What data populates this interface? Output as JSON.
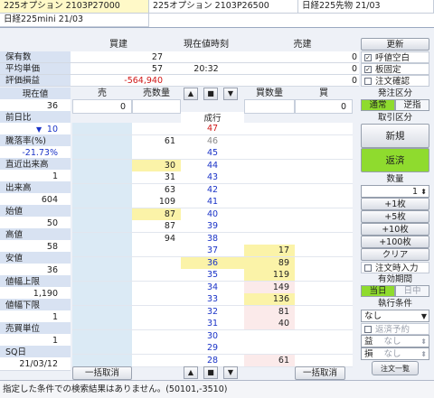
{
  "tabs": [
    "225オプション 2103P27000",
    "225オプション 2103P26500",
    "日経225先物 21/03",
    "日経225mini 21/03"
  ],
  "summary": {
    "headers": {
      "buy": "買建",
      "time": "現在値時刻",
      "sell": "売建"
    },
    "rows": [
      {
        "label": "保有数",
        "buy": "27",
        "time": "",
        "sell": "0"
      },
      {
        "label": "平均単価",
        "buy": "57",
        "time": "20:32",
        "sell": "0"
      },
      {
        "label": "評価損益",
        "buy": "-564,940",
        "time": "",
        "sell": "0"
      }
    ]
  },
  "board_header": {
    "sell": "売",
    "sell_qty": "売数量",
    "buy_qty": "買数量",
    "buy": "買",
    "market": "成行",
    "sell_input": "0",
    "buy_input": "0"
  },
  "quote": [
    {
      "label": "現在値",
      "value": "36",
      "color": "default"
    },
    {
      "label": "前日比",
      "value": "10",
      "color": "blue",
      "arrow": true
    },
    {
      "label": "騰落率(%)",
      "value": "-21.73%",
      "color": "blue"
    },
    {
      "label": "直近出来高",
      "value": "1",
      "color": "default"
    },
    {
      "label": "出来高",
      "value": "604",
      "color": "default"
    },
    {
      "label": "始値",
      "value": "50",
      "color": "default"
    },
    {
      "label": "高値",
      "value": "58",
      "color": "default"
    },
    {
      "label": "安値",
      "value": "36",
      "color": "default"
    },
    {
      "label": "値幅上限",
      "value": "1,190",
      "color": "default"
    },
    {
      "label": "値幅下限",
      "value": "1",
      "color": "default"
    },
    {
      "label": "売買単位",
      "value": "1",
      "color": "default"
    },
    {
      "label": "SQ日",
      "value": "21/03/12",
      "color": "default"
    }
  ],
  "book": [
    {
      "sell_qty": "",
      "price": "47",
      "buy_qty": "",
      "price_color": "red",
      "sq_hl": false,
      "bq_hl": false
    },
    {
      "sell_qty": "61",
      "price": "46",
      "buy_qty": "",
      "price_color": "gray",
      "sq_hl": false,
      "bq_hl": false
    },
    {
      "sell_qty": "",
      "price": "45",
      "buy_qty": "",
      "price_color": "blue",
      "sq_hl": false,
      "bq_hl": false
    },
    {
      "sell_qty": "30",
      "price": "44",
      "buy_qty": "",
      "price_color": "blue",
      "sq_hl": true,
      "bq_hl": false
    },
    {
      "sell_qty": "31",
      "price": "43",
      "buy_qty": "",
      "price_color": "blue",
      "sq_hl": false,
      "bq_hl": false
    },
    {
      "sell_qty": "63",
      "price": "42",
      "buy_qty": "",
      "price_color": "blue",
      "sq_hl": false,
      "bq_hl": false
    },
    {
      "sell_qty": "109",
      "price": "41",
      "buy_qty": "",
      "price_color": "blue",
      "sq_hl": false,
      "bq_hl": false
    },
    {
      "sell_qty": "87",
      "price": "40",
      "buy_qty": "",
      "price_color": "blue",
      "sq_hl": true,
      "bq_hl": false
    },
    {
      "sell_qty": "87",
      "price": "39",
      "buy_qty": "",
      "price_color": "blue",
      "sq_hl": false,
      "bq_hl": false
    },
    {
      "sell_qty": "94",
      "price": "38",
      "buy_qty": "",
      "price_color": "blue",
      "sq_hl": false,
      "bq_hl": false
    },
    {
      "sell_qty": "",
      "price": "37",
      "buy_qty": "17",
      "price_color": "blue",
      "sq_hl": false,
      "bq_hl": true
    },
    {
      "sell_qty": "",
      "price": "36",
      "buy_qty": "89",
      "price_color": "blue",
      "sq_hl": false,
      "bq_hl": true,
      "price_hl": true
    },
    {
      "sell_qty": "",
      "price": "35",
      "buy_qty": "119",
      "price_color": "blue",
      "sq_hl": false,
      "bq_hl": true
    },
    {
      "sell_qty": "",
      "price": "34",
      "buy_qty": "149",
      "price_color": "blue",
      "sq_hl": false,
      "bq_hl": false
    },
    {
      "sell_qty": "",
      "price": "33",
      "buy_qty": "136",
      "price_color": "blue",
      "sq_hl": false,
      "bq_hl": true
    },
    {
      "sell_qty": "",
      "price": "32",
      "buy_qty": "81",
      "price_color": "blue",
      "sq_hl": false,
      "bq_hl": false
    },
    {
      "sell_qty": "",
      "price": "31",
      "buy_qty": "40",
      "price_color": "blue",
      "sq_hl": false,
      "bq_hl": false
    },
    {
      "sell_qty": "",
      "price": "30",
      "buy_qty": "",
      "price_color": "blue",
      "sq_hl": false,
      "bq_hl": false
    },
    {
      "sell_qty": "",
      "price": "29",
      "buy_qty": "",
      "price_color": "blue",
      "sq_hl": false,
      "bq_hl": false
    },
    {
      "sell_qty": "",
      "price": "28",
      "buy_qty": "61",
      "price_color": "blue",
      "sq_hl": false,
      "bq_hl": false
    }
  ],
  "bottom": {
    "sell_cancel": "一括取消",
    "buy_cancel": "一括取消"
  },
  "panel": {
    "update": "更新",
    "checks": [
      {
        "label": "呼値空白",
        "checked": true
      },
      {
        "label": "板固定",
        "checked": true
      },
      {
        "label": "注文確認",
        "checked": false
      }
    ],
    "order_type_title": "発注区分",
    "order_types": [
      "通常",
      "逆指"
    ],
    "trade_type_title": "取引区分",
    "new_label": "新規",
    "close_label": "返済",
    "qty_title": "数量",
    "qty_value": "1",
    "qty_buttons": [
      "+1枚",
      "+5枚",
      "+10枚",
      "+100枚",
      "クリア"
    ],
    "bulk_check": "注文時入力",
    "validity_title": "有効期間",
    "validity": [
      "当日",
      "日中"
    ],
    "exec_title": "執行条件",
    "exec_value": "なし",
    "repay_check": "返済予約",
    "profit_label": "益",
    "profit_value": "なし",
    "loss_label": "損",
    "loss_value": "なし",
    "order_list": "注文一覧"
  },
  "status": "指定した条件での検索結果はありません。(50101,-3510)",
  "colors": {
    "red": "#d01818",
    "blue": "#1a33c7",
    "gray": "#8a8a8a",
    "green": "#8fdb2e",
    "yellow": "#fbf3a8"
  }
}
